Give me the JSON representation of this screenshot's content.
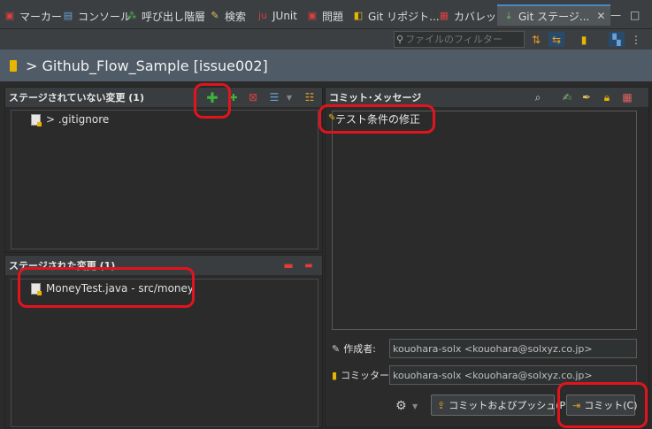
{
  "tabs": [
    {
      "label": "マーカー",
      "icon": "marker-icon"
    },
    {
      "label": "コンソール",
      "icon": "console-icon"
    },
    {
      "label": "呼び出し階層",
      "icon": "call-hierarchy-icon"
    },
    {
      "label": "検索",
      "icon": "search-icon"
    },
    {
      "label": "JUnit",
      "icon": "junit-icon"
    },
    {
      "label": "問題",
      "icon": "problems-icon"
    },
    {
      "label": "Git リポジト...",
      "icon": "git-repo-icon"
    },
    {
      "label": "カバレッジ",
      "icon": "coverage-icon"
    },
    {
      "label": "Git ステージ...",
      "icon": "git-staging-icon"
    }
  ],
  "filter": {
    "placeholder": "ファイルのフィルター"
  },
  "header": {
    "title": "> Github_Flow_Sample [issue002]"
  },
  "unstaged": {
    "title": "ステージされていない変更 (1)",
    "files": [
      {
        "label": "> .gitignore"
      }
    ]
  },
  "staged": {
    "title": "ステージされた変更 (1)",
    "files": [
      {
        "label": "MoneyTest.java - src/money"
      }
    ]
  },
  "commit": {
    "title": "コミット･メッセージ",
    "message": "テスト条件の修正",
    "author_label": "作成者:",
    "author_value": "kouohara-solx <kouohara@solxyz.co.jp>",
    "committer_label": "コミッター:",
    "committer_value": "kouohara-solx <kouohara@solxyz.co.jp>",
    "commit_push_label": "コミットおよびプッシュ(P)",
    "commit_label": "コミット(C)"
  },
  "colors": {
    "highlight": "#e1141e",
    "header_bg": "#4f5b66",
    "add_green": "#3cb43c",
    "remove_red": "#e23b3b"
  }
}
